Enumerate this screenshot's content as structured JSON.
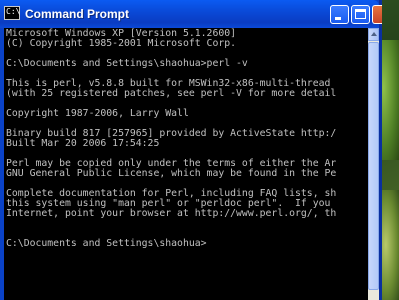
{
  "window": {
    "title": "Command Prompt",
    "icon": "console-icon"
  },
  "console": {
    "lines": [
      "Microsoft Windows XP [Version 5.1.2600]",
      "(C) Copyright 1985-2001 Microsoft Corp.",
      "C:\\Documents and Settings\\shaohua>perl -v",
      "This is perl, v5.8.8 built for MSWin32-x86-multi-thread",
      "(with 25 registered patches, see perl -V for more detail",
      "Copyright 1987-2006, Larry Wall",
      "Binary build 817 [257965] provided by ActiveState http:/",
      "Built Mar 20 2006 17:54:25",
      "Perl may be copied only under the terms of either the Ar",
      "GNU General Public License, which may be found in the Pe",
      "Complete documentation for Perl, including FAQ lists, sh",
      "this system using \"man perl\" or \"perldoc perl\".  If you",
      "Internet, point your browser at http://www.perl.org/, th",
      "C:\\Documents and Settings\\shaohua>"
    ]
  },
  "colors": {
    "console_background": "#000000",
    "console_text": "#c0c0c0",
    "titlebar": "#0a4ad8"
  }
}
